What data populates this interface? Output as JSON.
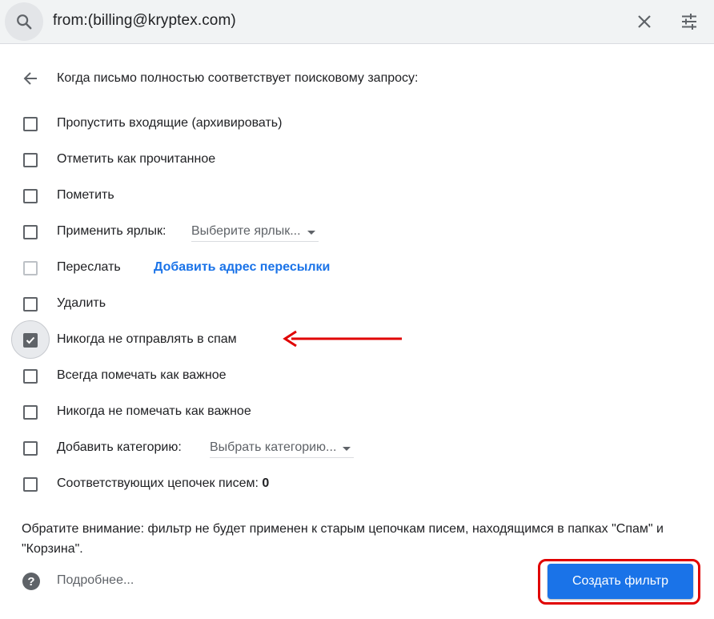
{
  "search": {
    "query": "from:(billing@kryptex.com)",
    "icons": {
      "search": "search-icon",
      "close": "close-icon",
      "options": "tune-icon"
    }
  },
  "filter": {
    "heading": "Когда письмо полностью соответствует поисковому запросу:",
    "options": [
      {
        "label": "Пропустить входящие (архивировать)",
        "checked": false
      },
      {
        "label": "Отметить как прочитанное",
        "checked": false
      },
      {
        "label": "Пометить",
        "checked": false
      },
      {
        "label": "Применить ярлык:",
        "checked": false,
        "select": "Выберите ярлык..."
      },
      {
        "label": "Переслать",
        "checked": false,
        "disabled": true,
        "link": "Добавить адрес пересылки"
      },
      {
        "label": "Удалить",
        "checked": false
      },
      {
        "label": "Никогда не отправлять в спам",
        "checked": true
      },
      {
        "label": "Всегда помечать как важное",
        "checked": false
      },
      {
        "label": "Никогда не помечать как важное",
        "checked": false
      },
      {
        "label": "Добавить категорию:",
        "checked": false,
        "select": "Выбрать категорию..."
      },
      {
        "label": "Соответствующих цепочек писем:",
        "checked": false,
        "count": "0"
      }
    ],
    "note": "Обратите внимание: фильтр не будет применен к старым цепочкам писем, находящимся в папках \"Спам\" и \"Корзина\".",
    "more_link": "Подробнее...",
    "create_button": "Создать фильтр"
  },
  "colors": {
    "accent": "#1a73e8",
    "annotation": "#e00000",
    "checkbox": "#5f6368"
  }
}
